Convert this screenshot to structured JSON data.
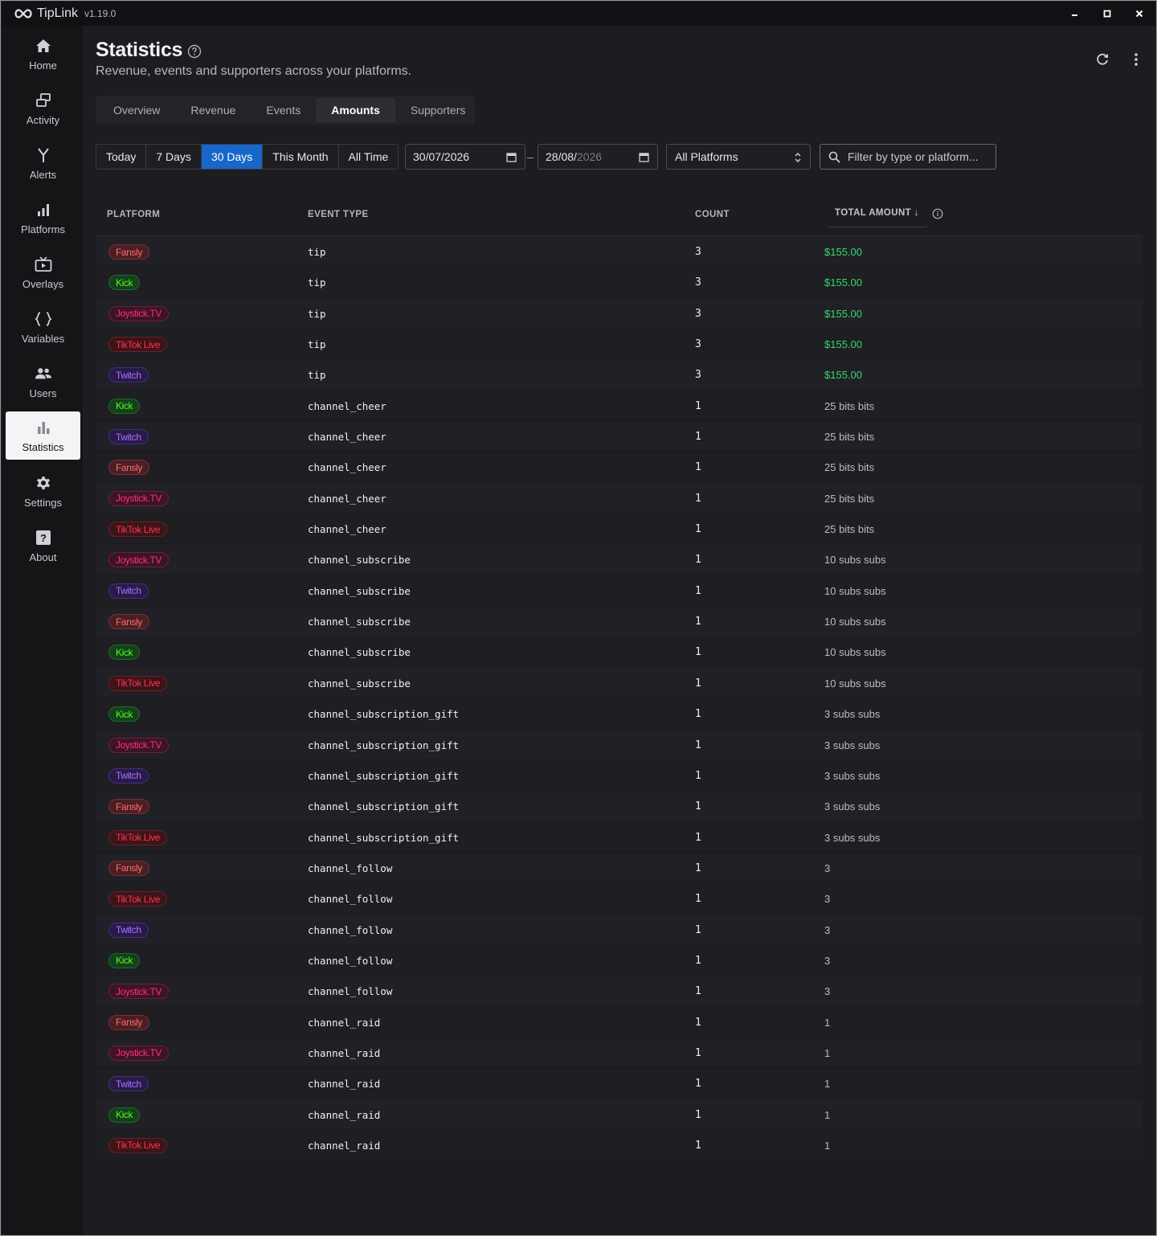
{
  "app": {
    "name": "TipLink",
    "version": "v1.19.0"
  },
  "window_controls": {
    "minimize": "–",
    "maximize": "◻",
    "close": "✕"
  },
  "sidebar": {
    "items": [
      {
        "label": "Home",
        "icon": "home-icon",
        "active": false
      },
      {
        "label": "Activity",
        "icon": "activity-icon",
        "active": false
      },
      {
        "label": "Alerts",
        "icon": "alerts-icon",
        "active": false
      },
      {
        "label": "Platforms",
        "icon": "platforms-icon",
        "active": false
      },
      {
        "label": "Overlays",
        "icon": "overlays-icon",
        "active": false
      },
      {
        "label": "Variables",
        "icon": "variables-icon",
        "active": false
      },
      {
        "label": "Users",
        "icon": "users-icon",
        "active": false
      },
      {
        "label": "Statistics",
        "icon": "statistics-icon",
        "active": true
      },
      {
        "label": "Settings",
        "icon": "settings-icon",
        "active": false
      },
      {
        "label": "About",
        "icon": "about-icon",
        "active": false
      }
    ]
  },
  "header": {
    "title": "Statistics",
    "subtitle": "Revenue, events and supporters across your platforms."
  },
  "tabs": [
    {
      "label": "Overview",
      "active": false
    },
    {
      "label": "Revenue",
      "active": false
    },
    {
      "label": "Events",
      "active": false
    },
    {
      "label": "Amounts",
      "active": true
    },
    {
      "label": "Supporters",
      "active": false
    }
  ],
  "filters": {
    "ranges": [
      {
        "label": "Today",
        "active": false
      },
      {
        "label": "7 Days",
        "active": false
      },
      {
        "label": "30 Days",
        "active": true
      },
      {
        "label": "This Month",
        "active": false
      },
      {
        "label": "All Time",
        "active": false
      }
    ],
    "date_from": "30/07/2026",
    "date_to_day": "28/08/",
    "date_to_year": "2026",
    "date_separator": "–",
    "platform_select": "All Platforms",
    "search_placeholder": "Filter by type or platform..."
  },
  "table": {
    "columns": {
      "platform": "PLATFORM",
      "event_type": "EVENT TYPE",
      "count": "COUNT",
      "total_amount": "TOTAL AMOUNT ↓"
    },
    "platform_colors": {
      "Fansly": {
        "bg": "#4a1f23",
        "fg": "#ff6b6b",
        "border": "#7a2f33"
      },
      "Kick": {
        "bg": "#14401c",
        "fg": "#53fc18",
        "border": "#1f6b2b"
      },
      "Joystick.TV": {
        "bg": "#3d1424",
        "fg": "#ff2d78",
        "border": "#6b2040"
      },
      "TikTok Live": {
        "bg": "#3d1418",
        "fg": "#ff3050",
        "border": "#6b2028"
      },
      "Twitch": {
        "bg": "#2a1a4a",
        "fg": "#a970ff",
        "border": "#45307a"
      }
    },
    "rows": [
      {
        "platform": "Fansly",
        "type": "tip",
        "count": "3",
        "amount": "$155.00",
        "money": true
      },
      {
        "platform": "Kick",
        "type": "tip",
        "count": "3",
        "amount": "$155.00",
        "money": true
      },
      {
        "platform": "Joystick.TV",
        "type": "tip",
        "count": "3",
        "amount": "$155.00",
        "money": true
      },
      {
        "platform": "TikTok Live",
        "type": "tip",
        "count": "3",
        "amount": "$155.00",
        "money": true
      },
      {
        "platform": "Twitch",
        "type": "tip",
        "count": "3",
        "amount": "$155.00",
        "money": true
      },
      {
        "platform": "Kick",
        "type": "channel_cheer",
        "count": "1",
        "amount": "25 bits bits",
        "money": false
      },
      {
        "platform": "Twitch",
        "type": "channel_cheer",
        "count": "1",
        "amount": "25 bits bits",
        "money": false
      },
      {
        "platform": "Fansly",
        "type": "channel_cheer",
        "count": "1",
        "amount": "25 bits bits",
        "money": false
      },
      {
        "platform": "Joystick.TV",
        "type": "channel_cheer",
        "count": "1",
        "amount": "25 bits bits",
        "money": false
      },
      {
        "platform": "TikTok Live",
        "type": "channel_cheer",
        "count": "1",
        "amount": "25 bits bits",
        "money": false
      },
      {
        "platform": "Joystick.TV",
        "type": "channel_subscribe",
        "count": "1",
        "amount": "10 subs subs",
        "money": false
      },
      {
        "platform": "Twitch",
        "type": "channel_subscribe",
        "count": "1",
        "amount": "10 subs subs",
        "money": false
      },
      {
        "platform": "Fansly",
        "type": "channel_subscribe",
        "count": "1",
        "amount": "10 subs subs",
        "money": false
      },
      {
        "platform": "Kick",
        "type": "channel_subscribe",
        "count": "1",
        "amount": "10 subs subs",
        "money": false
      },
      {
        "platform": "TikTok Live",
        "type": "channel_subscribe",
        "count": "1",
        "amount": "10 subs subs",
        "money": false
      },
      {
        "platform": "Kick",
        "type": "channel_subscription_gift",
        "count": "1",
        "amount": "3 subs subs",
        "money": false
      },
      {
        "platform": "Joystick.TV",
        "type": "channel_subscription_gift",
        "count": "1",
        "amount": "3 subs subs",
        "money": false
      },
      {
        "platform": "Twitch",
        "type": "channel_subscription_gift",
        "count": "1",
        "amount": "3 subs subs",
        "money": false
      },
      {
        "platform": "Fansly",
        "type": "channel_subscription_gift",
        "count": "1",
        "amount": "3 subs subs",
        "money": false
      },
      {
        "platform": "TikTok Live",
        "type": "channel_subscription_gift",
        "count": "1",
        "amount": "3 subs subs",
        "money": false
      },
      {
        "platform": "Fansly",
        "type": "channel_follow",
        "count": "1",
        "amount": "3",
        "money": false
      },
      {
        "platform": "TikTok Live",
        "type": "channel_follow",
        "count": "1",
        "amount": "3",
        "money": false
      },
      {
        "platform": "Twitch",
        "type": "channel_follow",
        "count": "1",
        "amount": "3",
        "money": false
      },
      {
        "platform": "Kick",
        "type": "channel_follow",
        "count": "1",
        "amount": "3",
        "money": false
      },
      {
        "platform": "Joystick.TV",
        "type": "channel_follow",
        "count": "1",
        "amount": "3",
        "money": false
      },
      {
        "platform": "Fansly",
        "type": "channel_raid",
        "count": "1",
        "amount": "1",
        "money": false
      },
      {
        "platform": "Joystick.TV",
        "type": "channel_raid",
        "count": "1",
        "amount": "1",
        "money": false
      },
      {
        "platform": "Twitch",
        "type": "channel_raid",
        "count": "1",
        "amount": "1",
        "money": false
      },
      {
        "platform": "Kick",
        "type": "channel_raid",
        "count": "1",
        "amount": "1",
        "money": false
      },
      {
        "platform": "TikTok Live",
        "type": "channel_raid",
        "count": "1",
        "amount": "1",
        "money": false
      }
    ]
  }
}
